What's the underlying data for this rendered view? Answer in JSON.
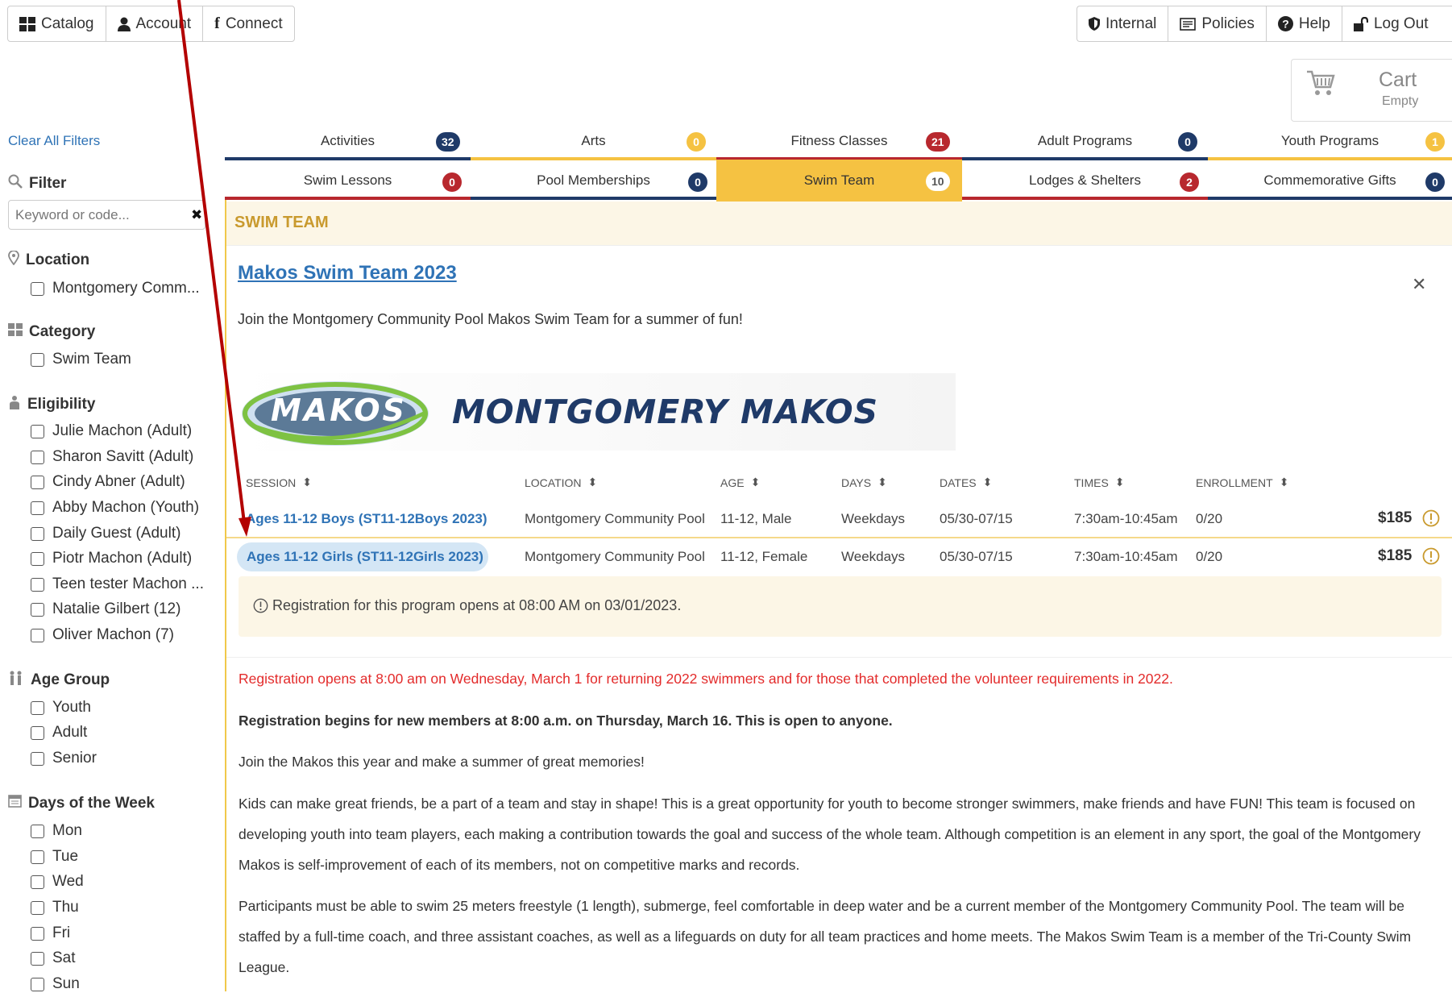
{
  "topnav_left": [
    {
      "label": "Catalog",
      "icon": "grid-icon"
    },
    {
      "label": "Account",
      "icon": "user-icon"
    },
    {
      "label": "Connect",
      "icon": "facebook-icon"
    }
  ],
  "topnav_right": [
    {
      "label": "Internal",
      "icon": "shield-icon"
    },
    {
      "label": "Policies",
      "icon": "policies-icon"
    },
    {
      "label": "Help",
      "icon": "question-icon"
    },
    {
      "label": "Log Out",
      "icon": "unlock-icon"
    }
  ],
  "cart": {
    "title": "Cart",
    "status": "Empty"
  },
  "sidebar": {
    "clear_all": "Clear All Filters",
    "filter_title": "Filter",
    "search_placeholder": "Keyword or code...",
    "location_title": "Location",
    "location_items": [
      "Montgomery Comm..."
    ],
    "category_title": "Category",
    "category_items": [
      "Swim Team"
    ],
    "eligibility_title": "Eligibility",
    "eligibility_items": [
      "Julie Machon (Adult)",
      "Sharon Savitt (Adult)",
      "Cindy Abner (Adult)",
      "Abby Machon (Youth)",
      "Daily Guest (Adult)",
      "Piotr Machon (Adult)",
      "Teen tester Machon ...",
      "Natalie Gilbert (12)",
      "Oliver Machon (7)"
    ],
    "age_group_title": "Age Group",
    "age_group_items": [
      "Youth",
      "Adult",
      "Senior"
    ],
    "days_title": "Days of the Week",
    "days_items": [
      "Mon",
      "Tue",
      "Wed",
      "Thu",
      "Fri",
      "Sat",
      "Sun"
    ]
  },
  "tabs_row1": [
    {
      "label": "Activities",
      "count": "32",
      "color": "#1f3a68"
    },
    {
      "label": "Arts",
      "count": "0",
      "color": "#f5c242"
    },
    {
      "label": "Fitness Classes",
      "count": "21",
      "color": "#b8282e"
    },
    {
      "label": "Adult Programs",
      "count": "0",
      "color": "#1f3a68"
    },
    {
      "label": "Youth Programs",
      "count": "1",
      "color": "#f5c242"
    }
  ],
  "tabs_row2": [
    {
      "label": "Swim Lessons",
      "count": "0",
      "color": "#b8282e"
    },
    {
      "label": "Pool Memberships",
      "count": "0",
      "color": "#1f3a68"
    },
    {
      "label": "Swim Team",
      "count": "10",
      "color": "#f5c242"
    },
    {
      "label": "Lodges & Shelters",
      "count": "2",
      "color": "#b8282e"
    },
    {
      "label": "Commemorative Gifts",
      "count": "0",
      "color": "#1f3a68"
    }
  ],
  "section_header": "SWIM TEAM",
  "program": {
    "title": "Makos Swim Team 2023",
    "intro": "Join the Montgomery Community Pool Makos Swim Team for a summer of fun!",
    "logo_badge": "MAKOS",
    "logo_text": "MONTGOMERY MAKOS"
  },
  "table": {
    "headers": [
      "SESSION",
      "LOCATION",
      "AGE",
      "DAYS",
      "DATES",
      "TIMES",
      "ENROLLMENT"
    ],
    "rows": [
      {
        "session": "Ages 11-12 Boys (ST11-12Boys 2023)",
        "location": "Montgomery Community Pool",
        "age": "11-12, Male",
        "days": "Weekdays",
        "dates": "05/30-07/15",
        "times": "7:30am-10:45am",
        "enrollment": "0/20",
        "price": "$185"
      },
      {
        "session": "Ages 11-12 Girls (ST11-12Girls 2023)",
        "location": "Montgomery Community Pool",
        "age": "11-12, Female",
        "days": "Weekdays",
        "dates": "05/30-07/15",
        "times": "7:30am-10:45am",
        "enrollment": "0/20",
        "price": "$185"
      }
    ],
    "notice": "Registration for this program opens at 08:00 AM on 03/01/2023."
  },
  "description": {
    "red_notice": "Registration opens at 8:00 am on Wednesday, March 1 for returning 2022 swimmers and for those that completed the volunteer requirements in 2022.",
    "bold_notice": "Registration begins for new members at 8:00 a.m. on Thursday, March 16. This is open to anyone.",
    "p1": "Join the Makos this year and make a summer of great memories!",
    "p2": "Kids can make great friends, be a part of a team and stay in shape! This is a great opportunity for youth to become stronger swimmers, make friends and have FUN! This team is focused on developing youth into team players, each making a contribution towards the goal and success of the whole team. Although competition is an element in any sport, the goal of the Montgomery Makos is self-improvement of each of its members, not on competitive marks and records.",
    "p3": "Participants must be able to swim 25 meters freestyle (1 length), submerge, feel comfortable in deep water and be a current member of the Montgomery Community Pool. The team will be staffed by a full-time coach, and three assistant coaches, as well as a lifeguards on duty for all team practices and home meets. The Makos Swim Team is a member of the Tri-County Swim League."
  },
  "colors": {
    "navy": "#1f3a68",
    "gold": "#f5c242",
    "red": "#b8282e",
    "link": "#2f73b6",
    "annotation_arrow": "#b30000"
  }
}
